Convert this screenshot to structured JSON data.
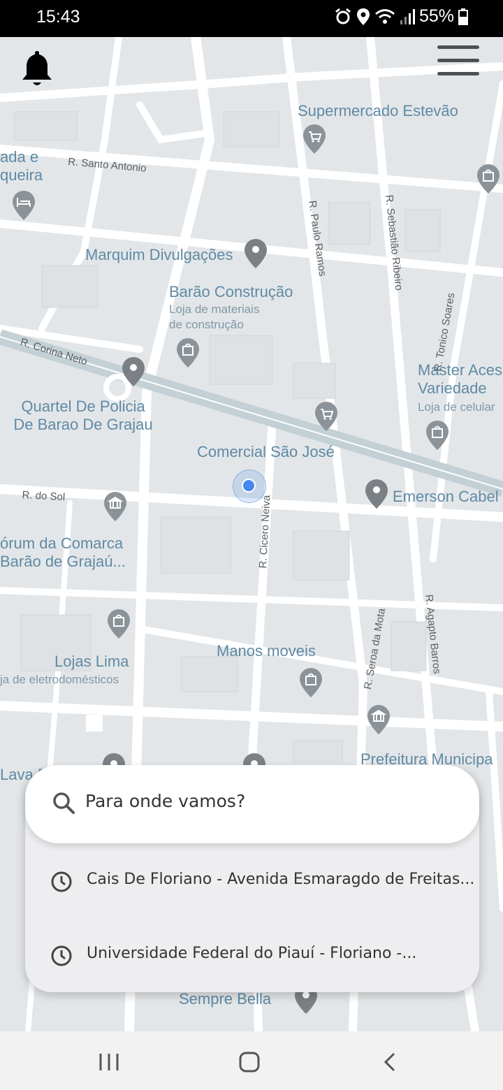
{
  "status_bar": {
    "time": "15:43",
    "battery": "55%",
    "icons": [
      "alarm-icon",
      "location-icon",
      "wifi-icon",
      "signal-icon",
      "battery-icon"
    ]
  },
  "map": {
    "pois": [
      {
        "name": "Supermercado Estevão",
        "type": "cart-icon"
      },
      {
        "name": "Marquim Divulgações",
        "type": "pin-icon"
      },
      {
        "name": "Barão Construção",
        "subtitle": "Loja de materiais de construção",
        "type": "shop-icon"
      },
      {
        "name": "Quartel De Policia De Barao De Grajau",
        "type": "pin-icon"
      },
      {
        "name": "Comercial São José",
        "type": "cart-icon"
      },
      {
        "name": "Master Aces e Variedade",
        "subtitle": "Loja de celular",
        "type": "shop-icon"
      },
      {
        "name": "Emerson Cabel",
        "type": "pin-icon"
      },
      {
        "name": "órum da Comarca Barão de Grajaú...",
        "type": "government-icon"
      },
      {
        "name": "Lojas Lima",
        "subtitle": "ja de eletrodomésticos",
        "type": "shop-icon"
      },
      {
        "name": "Manos moveis",
        "type": "shop-icon"
      },
      {
        "name": "Prefeitura Municipa rajaú",
        "type": "government-icon"
      },
      {
        "name": "ada e queira",
        "type": "hotel-icon"
      },
      {
        "name": "Lava R",
        "type": "pin-icon"
      },
      {
        "name": "Sempre Bella",
        "type": "pin-icon"
      }
    ],
    "streets": [
      "R. Santo Antonio",
      "R. Paulo Ramos",
      "R. Sebastião Ribeiro",
      "R. Corina Neto",
      "R. Tonico Soares",
      "R. do Sol",
      "R. Cicero Neiva",
      "R. Seroa da Mota",
      "R. Agapto Barros"
    ]
  },
  "search": {
    "placeholder": "Para onde vamos?"
  },
  "recent_destinations": [
    {
      "label": "Cais De Floriano - Avenida Esmaragdo de Freitas..."
    },
    {
      "label": "Universidade Federal do Piauí - Floriano -..."
    }
  ],
  "colors": {
    "map_background": "#e3e6e8",
    "road": "#ffffff",
    "poi_text": "#5f8aa6",
    "pin": "#777b80",
    "user_location": "#4488ee"
  }
}
